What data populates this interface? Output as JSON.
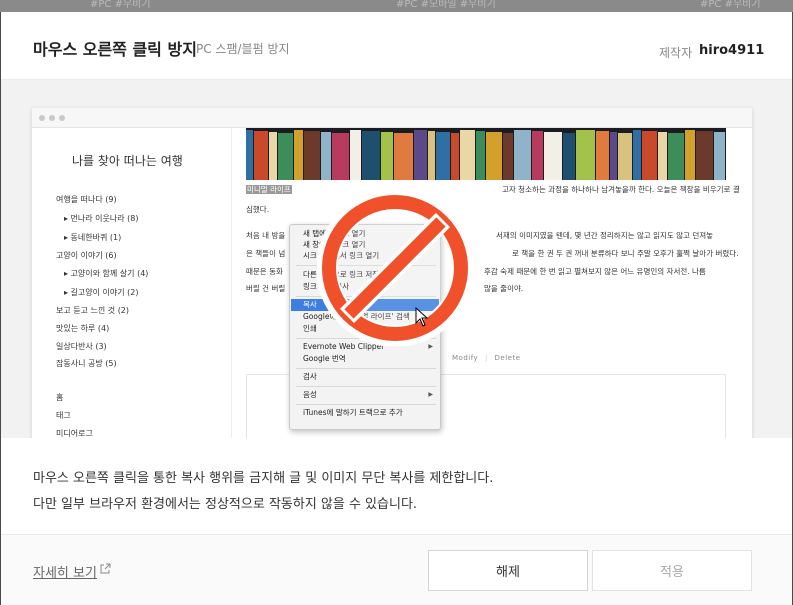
{
  "backdrop": {
    "tags_left": "#PC  #우비기",
    "tags_mid": "#PC  #모바일  #우비기",
    "tags_right": "#PC  #우비기"
  },
  "header": {
    "title": "마우스 오른쪽 클릭 방지",
    "subtitle": "PC 스팸/블펌 방지",
    "maker_label": "제작자",
    "maker_name": "hiro4911"
  },
  "preview": {
    "blog_title": "나를 찾아 떠나는 여행",
    "sidebar": [
      "여행을 떠나다 (9)",
      "▸ 먼나라 이웃나라 (8)",
      "▸ 동네한바퀴 (1)",
      "고양이 이야기 (6)",
      "▸ 고양이와 함께 살기 (4)",
      "▸ 길고양이 이야기 (2)",
      "보고 듣고 느낀 것 (2)",
      "맛있는 하루 (4)",
      "일상다반사 (3)",
      "잡동사니 공방 (5)",
      "홈",
      "태그",
      "미디어로그"
    ],
    "post_lines": [
      "미니멀 라이프",
      "고자 청소하는 과정을 하나하나 남겨놓을까 한다. 오늘은 책장을 비우기로 결",
      "심했다.",
      "처음 내 방을",
      "서재의 이미지였을 텐데, 몇 년간 정리하지는 않고 읽지도 않고 던져놓",
      "은 책들이 넘",
      "로 책을 한 권 두 권 꺼내 분류하다 보니 주말 오후가 훌쩍 날아가 버렸다.",
      "때문은 동화",
      "후감 숙제 때문에 한 번 읽고 펼쳐보지 않은 어느 유명인의 자서전. 나름",
      "버릴 건 버릴",
      "많을 줄이야."
    ],
    "modify": "Modify",
    "delete": "Delete",
    "context_menu": [
      "새 탭에서 링크 열기",
      "새 창에서 링크 열기",
      "시크릿 창에서 링크 열기",
      "다른 이름으로 링크 저장...",
      "링크 주소 복사",
      "복사",
      "Google에서 '미니멀 라이프' 검색",
      "인쇄",
      "Evernote Web Clipper",
      "Google 번역",
      "검사",
      "음성",
      "iTunes에 말하기 트랙으로 추가"
    ]
  },
  "description": {
    "line1": "마우스 오른쪽 클릭을 통한 복사 행위를 금지해 글 및 이미지 무단 복사를 제한합니다.",
    "line2": "다만 일부 브라우저 환경에서는 정상적으로 작동하지 않을 수 있습니다."
  },
  "footer": {
    "detail_link": "자세히 보기",
    "release_button": "해제",
    "apply_button": "적용"
  },
  "colors": {
    "prohibit_red": "#f0502a",
    "menu_highlight": "#3d7fe1",
    "title_text": "#222222"
  },
  "icons": {
    "external_link": "external-link-icon",
    "prohibit": "no-sign-icon",
    "cursor": "cursor-icon"
  }
}
